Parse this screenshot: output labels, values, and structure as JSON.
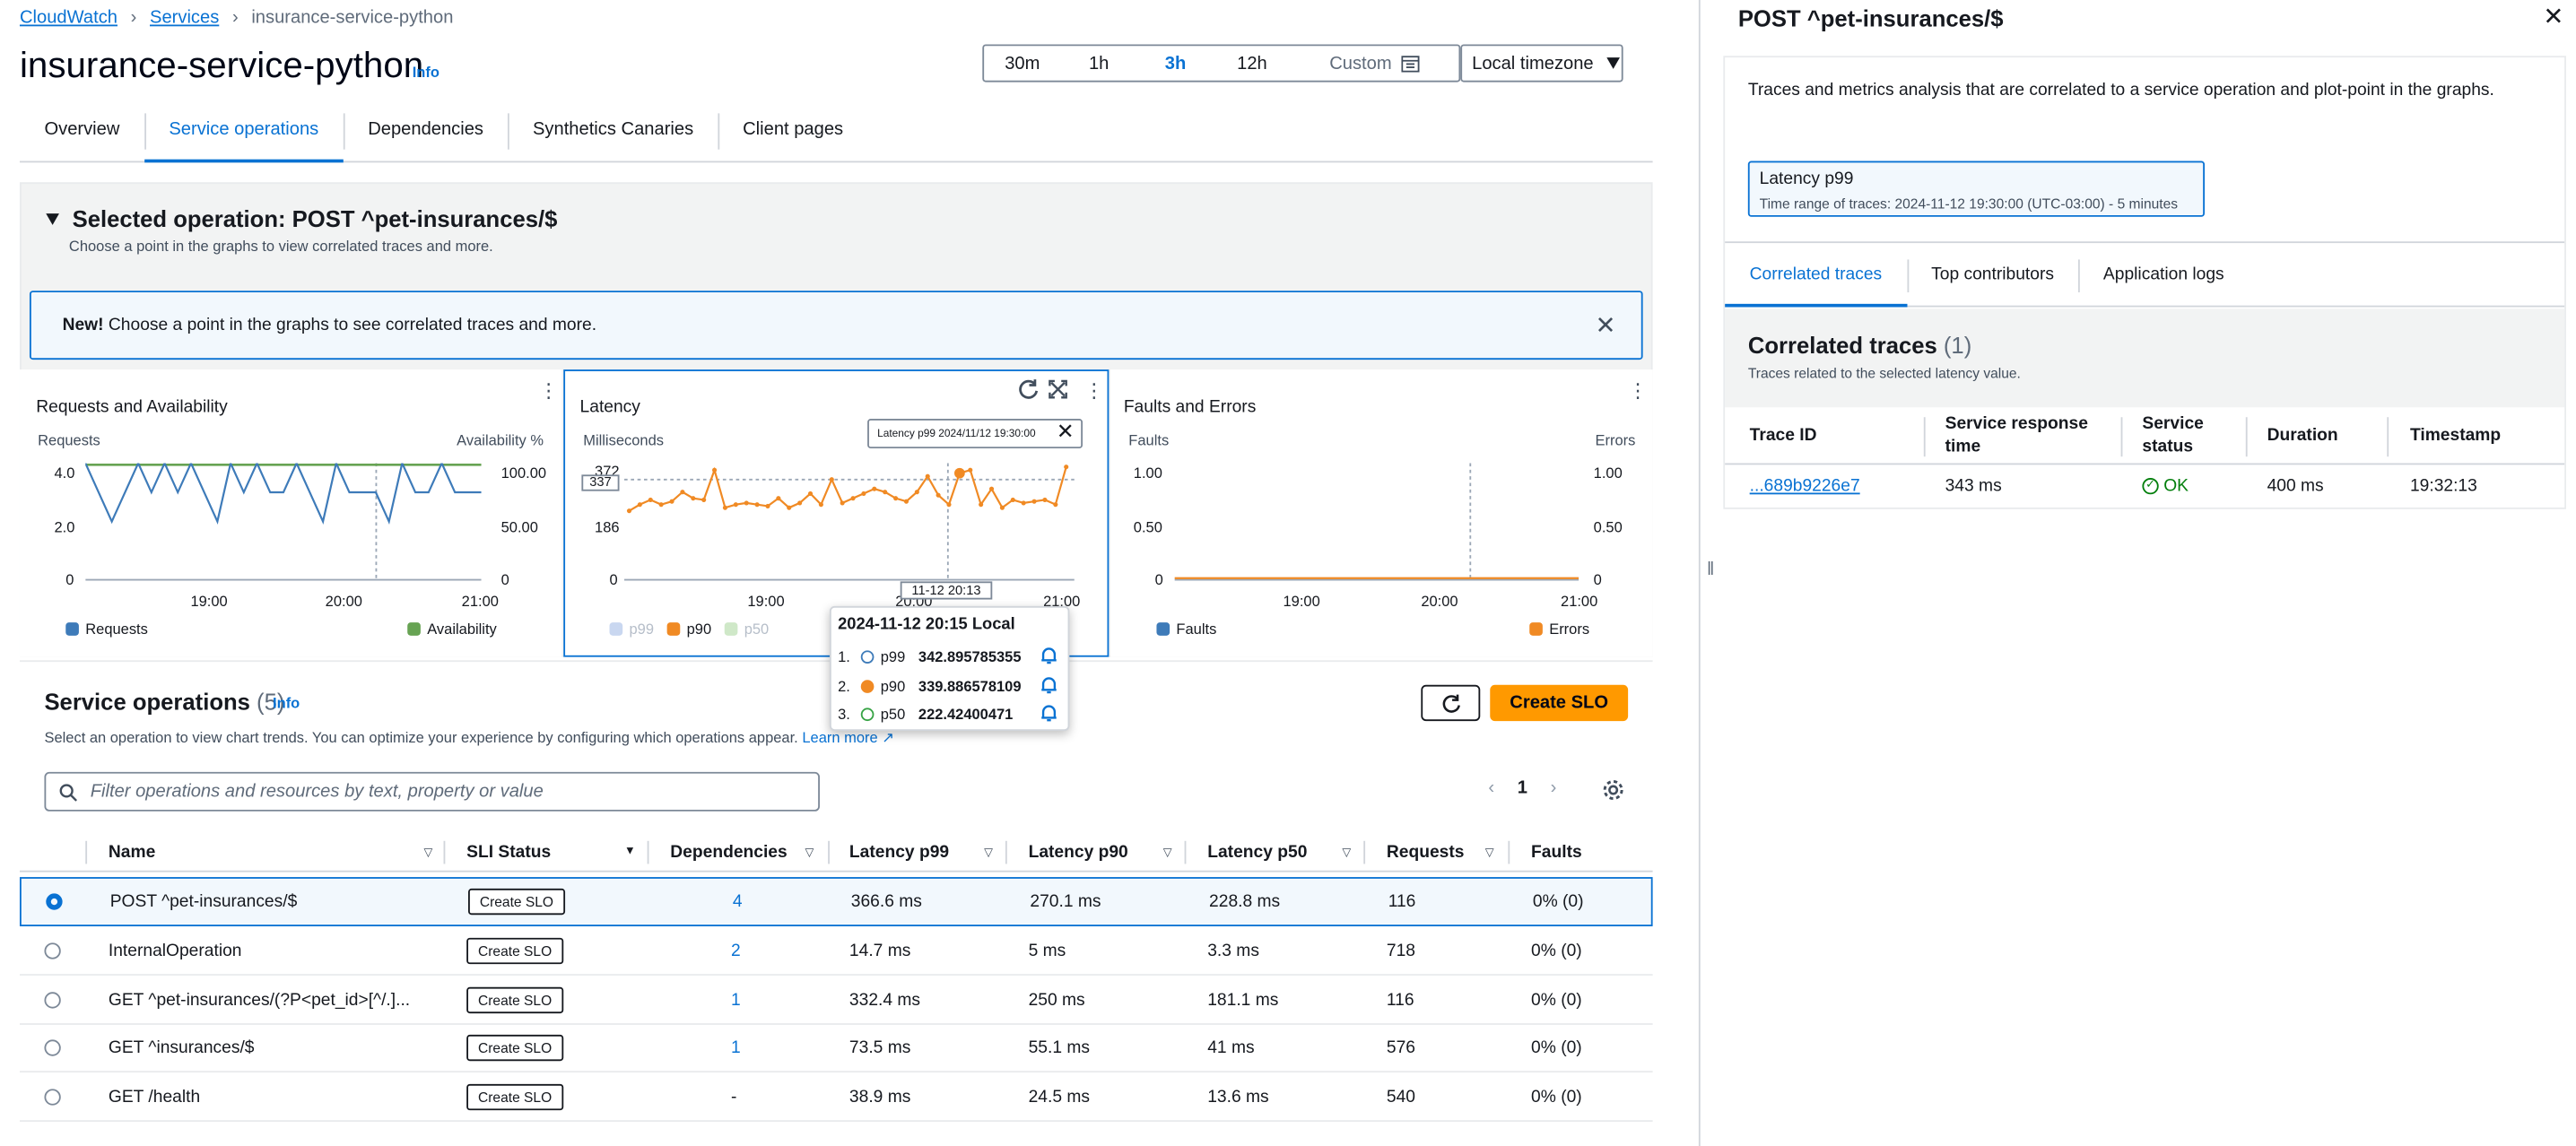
{
  "breadcrumb": {
    "items": [
      "CloudWatch",
      "Services"
    ],
    "current": "insurance-service-python"
  },
  "page": {
    "title": "insurance-service-python",
    "info": "Info"
  },
  "time_range": {
    "options": [
      "30m",
      "1h",
      "3h",
      "12h"
    ],
    "active": "3h",
    "custom": "Custom",
    "timezone": "Local timezone"
  },
  "tabs": [
    "Overview",
    "Service operations",
    "Dependencies",
    "Synthetics Canaries",
    "Client pages"
  ],
  "active_tab": "Service operations",
  "selected_operation": {
    "title": "Selected operation: POST ^pet-insurances/$",
    "subtitle": "Choose a point in the graphs to view correlated traces and more.",
    "banner_bold": "New!",
    "banner_text": "Choose a point in the graphs to see correlated traces and more."
  },
  "charts": {
    "requests": {
      "title": "Requests and Availability",
      "left_label": "Requests",
      "right_label": "Availability %",
      "left_ticks": [
        "4.0",
        "2.0",
        "0"
      ],
      "right_ticks": [
        "100.00",
        "50.00",
        "0"
      ],
      "x_ticks": [
        "19:00",
        "20:00",
        "21:00"
      ],
      "legend": [
        "Requests",
        "Availability"
      ]
    },
    "latency": {
      "title": "Latency",
      "left_label": "Milliseconds",
      "left_ticks": [
        "372",
        "186",
        "0"
      ],
      "x_ticks": [
        "19:00",
        "20:00",
        "21:00"
      ],
      "legend": [
        "p99",
        "p90",
        "p50"
      ],
      "selection_label": "Latency p99 2024/11/12 19:30:00",
      "hover_x": "11-12 20:13",
      "hover_y": "337",
      "tooltip": {
        "header": "2024-11-12 20:15 Local",
        "rows": [
          {
            "num": "1.",
            "name": "p99",
            "value": "342.895785355"
          },
          {
            "num": "2.",
            "name": "p90",
            "value": "339.886578109"
          },
          {
            "num": "3.",
            "name": "p50",
            "value": "222.42400471"
          }
        ]
      }
    },
    "faults": {
      "title": "Faults and Errors",
      "left_label": "Faults",
      "right_label": "Errors",
      "left_ticks": [
        "1.00",
        "0.50",
        "0"
      ],
      "right_ticks": [
        "1.00",
        "0.50",
        "0"
      ],
      "x_ticks": [
        "19:00",
        "20:00",
        "21:00"
      ],
      "legend": [
        "Faults",
        "Errors"
      ]
    }
  },
  "chart_data": [
    {
      "type": "line",
      "title": "Requests and Availability",
      "x_range": [
        "18:00",
        "21:00"
      ],
      "series": [
        {
          "name": "Requests",
          "axis": "left",
          "values": [
            4,
            3,
            2,
            3,
            4,
            3,
            4,
            3,
            4,
            3,
            2,
            4,
            3,
            4,
            3,
            3,
            4,
            3,
            2,
            4,
            3,
            3,
            3,
            2,
            4,
            3,
            3,
            4,
            3,
            3,
            3
          ]
        },
        {
          "name": "Availability",
          "axis": "right",
          "values": [
            100,
            100,
            100,
            100,
            100,
            100,
            100,
            100,
            100,
            100,
            100,
            100,
            100,
            100,
            100,
            100,
            100,
            100,
            100,
            100,
            100,
            100,
            100,
            100,
            100,
            100,
            100,
            100,
            100,
            100,
            100
          ]
        }
      ],
      "ylim_left": [
        0,
        4
      ],
      "ylim_right": [
        0,
        100
      ]
    },
    {
      "type": "line",
      "title": "Latency",
      "x_range": [
        "18:00",
        "21:00"
      ],
      "series": [
        {
          "name": "p90",
          "values": [
            220,
            240,
            255,
            240,
            250,
            280,
            260,
            255,
            350,
            230,
            240,
            245,
            240,
            235,
            260,
            230,
            245,
            275,
            240,
            320,
            245,
            260,
            275,
            290,
            280,
            260,
            250,
            280,
            330,
            270,
            240,
            340,
            350,
            240,
            290,
            230,
            255,
            245,
            250,
            255,
            240,
            360
          ]
        }
      ],
      "ylim": [
        0,
        372
      ]
    },
    {
      "type": "line",
      "title": "Faults and Errors",
      "x_range": [
        "18:00",
        "21:00"
      ],
      "series": [
        {
          "name": "Faults",
          "values": [
            0,
            0
          ]
        },
        {
          "name": "Errors",
          "values": [
            0,
            0
          ]
        }
      ],
      "ylim": [
        0,
        1
      ]
    }
  ],
  "service_operations": {
    "title": "Service operations",
    "count": "(5)",
    "info": "Info",
    "description": "Select an operation to view chart trends. You can optimize your experience by configuring which operations appear.",
    "learn_more": "Learn more",
    "create_slo": "Create SLO",
    "filter_placeholder": "Filter operations and resources by text, property or value",
    "page": "1",
    "columns": [
      "Name",
      "SLI Status",
      "Dependencies",
      "Latency p99",
      "Latency p90",
      "Latency p50",
      "Requests",
      "Faults"
    ],
    "row_button": "Create SLO",
    "rows": [
      {
        "name": "POST ^pet-insurances/$",
        "deps": "4",
        "p99": "366.6 ms",
        "p90": "270.1 ms",
        "p50": "228.8 ms",
        "requests": "116",
        "faults": "0% (0)"
      },
      {
        "name": "InternalOperation",
        "deps": "2",
        "p99": "14.7 ms",
        "p90": "5 ms",
        "p50": "3.3 ms",
        "requests": "718",
        "faults": "0% (0)"
      },
      {
        "name": "GET ^pet-insurances/(?P<pet_id>[^/.]...",
        "deps": "1",
        "p99": "332.4 ms",
        "p90": "250 ms",
        "p50": "181.1 ms",
        "requests": "116",
        "faults": "0% (0)"
      },
      {
        "name": "GET ^insurances/$",
        "deps": "1",
        "p99": "73.5 ms",
        "p90": "55.1 ms",
        "p50": "41 ms",
        "requests": "576",
        "faults": "0% (0)"
      },
      {
        "name": "GET /health",
        "deps": "-",
        "p99": "38.9 ms",
        "p90": "24.5 ms",
        "p50": "13.6 ms",
        "requests": "540",
        "faults": "0% (0)"
      }
    ]
  },
  "right_panel": {
    "title": "POST ^pet-insurances/$",
    "description": "Traces and metrics analysis that are correlated to a service operation and plot-point in the graphs.",
    "latency_box_title": "Latency p99",
    "latency_box_range": "Time range of traces: 2024-11-12 19:30:00 (UTC-03:00) - 5 minutes",
    "tabs": [
      "Correlated traces",
      "Top contributors",
      "Application logs"
    ],
    "correlated_title": "Correlated traces",
    "correlated_count": "(1)",
    "correlated_sub": "Traces related to the selected latency value.",
    "columns": [
      "Trace ID",
      "Service response time",
      "Service status",
      "Duration",
      "Timestamp"
    ],
    "row": {
      "trace_id": "...689b9226e7",
      "response": "343 ms",
      "status": "OK",
      "duration": "400 ms",
      "timestamp": "19:32:13"
    }
  },
  "colors": {
    "accent": "#0972d3",
    "orange": "#ff9900",
    "p90": "#f08a24",
    "requests": "#3e7bb9",
    "availability": "#67a353",
    "ok": "#037f0c"
  }
}
